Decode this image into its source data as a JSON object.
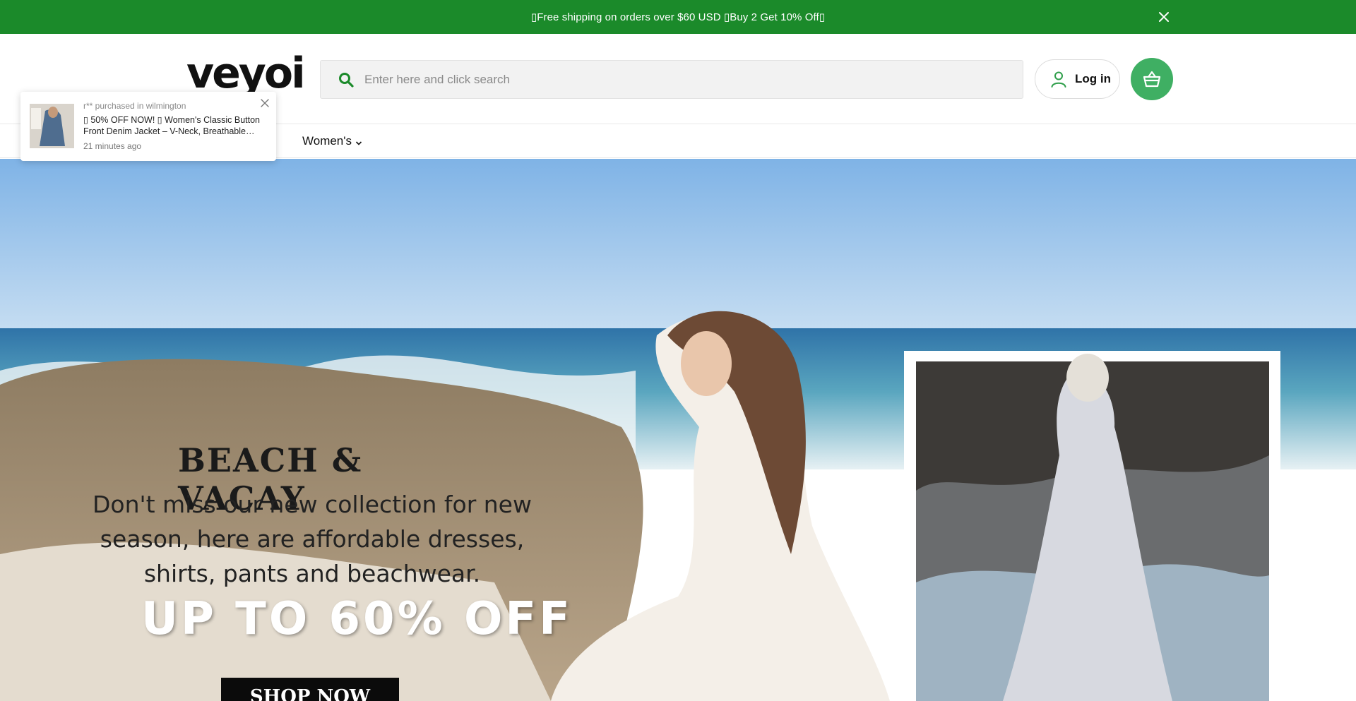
{
  "announcement": {
    "text": "▯Free shipping on orders over $60 USD ▯Buy 2 Get 10% Off▯"
  },
  "header": {
    "logo_text": "veyoi",
    "search_placeholder": "Enter here and click search",
    "login_label": "Log in"
  },
  "nav": {
    "items": [
      {
        "label": ""
      },
      {
        "label": "Women's"
      }
    ]
  },
  "hero": {
    "title": "BEACH & VACAY",
    "subtitle": "Don't miss our new collection for new season, here are affordable dresses, shirts, pants and beachwear.",
    "offer": "UP TO 60% OFF",
    "cta_label": "SHOP NOW"
  },
  "popup": {
    "meta": "r** purchased in wilmington",
    "product": "▯ 50% OFF NOW! ▯ Women's Classic Button Front Denim Jacket – V-Neck, Breathable…",
    "time": "21 minutes ago"
  },
  "colors": {
    "announce_bg": "#1b8a2a",
    "accent_green": "#1b8a2a",
    "cart_bg": "#3faf63"
  },
  "icons": [
    "close-icon",
    "search-icon",
    "user-icon",
    "cart-icon",
    "chevron-down-icon"
  ]
}
